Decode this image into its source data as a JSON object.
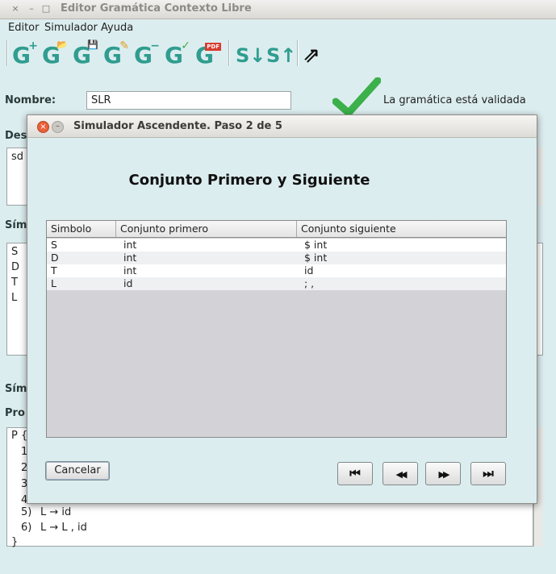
{
  "window": {
    "title": "Editor Gramática Contexto Libre",
    "close_glyph": "×",
    "min_glyph": "–",
    "max_glyph": "□"
  },
  "menu": {
    "items": [
      "Editor",
      "Simulador",
      "Ayuda"
    ]
  },
  "toolbar": {
    "icons": [
      {
        "name": "new-grammar-icon",
        "glyph": "G",
        "badge": "+"
      },
      {
        "name": "open-grammar-icon",
        "glyph": "G",
        "badge": "📂"
      },
      {
        "name": "save-grammar-icon",
        "glyph": "G",
        "badge": "💾"
      },
      {
        "name": "edit-grammar-icon",
        "glyph": "G",
        "badge": "✎"
      },
      {
        "name": "remove-grammar-icon",
        "glyph": "G",
        "badge": "−"
      },
      {
        "name": "validate-grammar-icon",
        "glyph": "G",
        "badge": "✓"
      },
      {
        "name": "pdf-grammar-icon",
        "glyph": "G",
        "badge": "PDF"
      },
      {
        "name": "simulate-down-icon",
        "glyph": "S↓"
      },
      {
        "name": "simulate-up-icon",
        "glyph": "S↑"
      },
      {
        "name": "export-icon",
        "glyph": "⇗"
      }
    ]
  },
  "form": {
    "nombre_label": "Nombre:",
    "nombre_value": "SLR",
    "validation_text": "La gramática está validada",
    "descripcion_label_partial": "Des",
    "descripcion_value_partial": "sd",
    "simbolos_label_partial": "Sím",
    "simbolos_list": [
      "S",
      "D",
      "T",
      "L"
    ],
    "simbolo_inicial_label_partial": "Sím",
    "producciones_label_partial": "Pro"
  },
  "productions": {
    "open": "P {",
    "lines": [
      {
        "num": "1",
        "text": ""
      },
      {
        "num": "2",
        "text": ""
      },
      {
        "num": "3",
        "text": ""
      },
      {
        "num": "4",
        "text": ""
      },
      {
        "num": "5)",
        "text": "L → id"
      },
      {
        "num": "6)",
        "text": "L → L , id"
      }
    ],
    "close": "}"
  },
  "dialog": {
    "title": "Simulador Ascendente. Paso 2 de 5",
    "heading": "Conjunto Primero y Siguiente",
    "columns": [
      "Simbolo",
      "Conjunto primero",
      "Conjunto siguiente"
    ],
    "rows": [
      [
        "S",
        "int",
        "$ int"
      ],
      [
        "D",
        "int",
        "$ int"
      ],
      [
        "T",
        "int",
        "id"
      ],
      [
        "L",
        "id",
        "; ,"
      ]
    ],
    "cancel_label": "Cancelar",
    "nav": {
      "first": "⏮",
      "prev": "◀◀",
      "next": "▶▶",
      "last": "⏭"
    }
  },
  "colors": {
    "background": "#dcedef",
    "icon_teal": "#2f9d8f",
    "check_green": "#3cb04a",
    "close_orange": "#e9603a"
  }
}
